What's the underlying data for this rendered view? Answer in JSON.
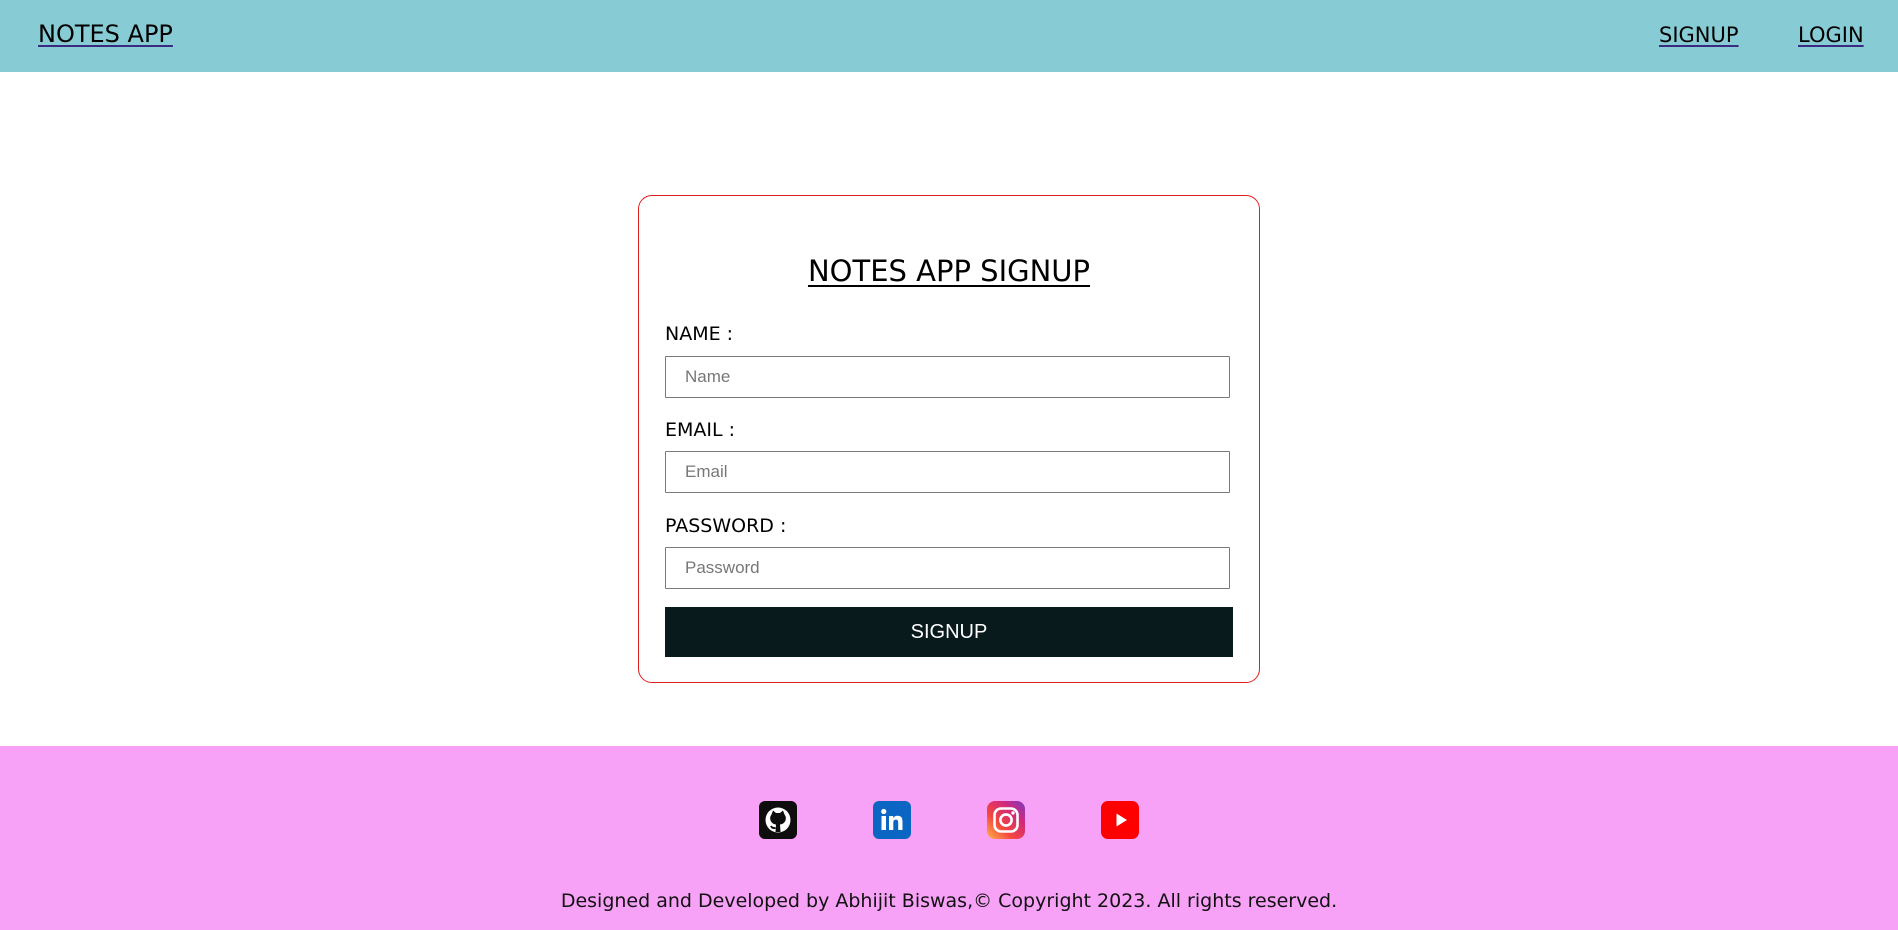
{
  "header": {
    "brand": "NOTES APP",
    "nav": {
      "signup": "SIGNUP",
      "login": "LOGIN"
    }
  },
  "form": {
    "title": "NOTES APP SIGNUP",
    "name_label": "NAME :",
    "name_placeholder": "Name",
    "email_label": "EMAIL :",
    "email_placeholder": "Email",
    "password_label": "PASSWORD :",
    "password_placeholder": "Password",
    "submit_label": "SIGNUP"
  },
  "footer": {
    "social_icons": [
      "github-icon",
      "linkedin-icon",
      "instagram-icon",
      "youtube-icon"
    ],
    "copyright": "Designed and Developed by Abhijit Biswas,© Copyright 2023. All rights reserved."
  },
  "colors": {
    "header_bg": "#87ccd5",
    "footer_bg": "#f7a1f7",
    "card_border": "#e01f1f",
    "button_bg": "#081a1b"
  }
}
